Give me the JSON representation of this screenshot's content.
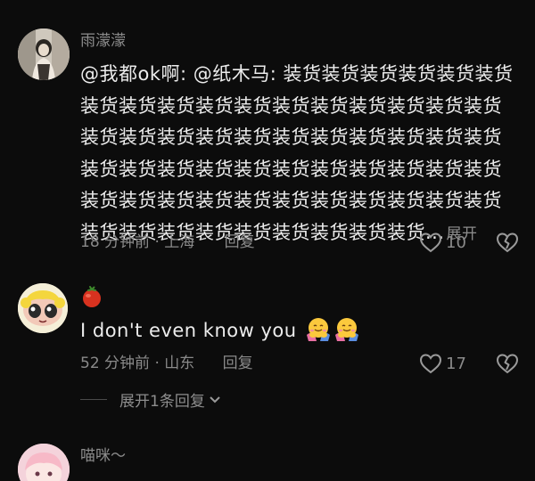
{
  "comments": [
    {
      "username": "雨濛濛",
      "text": "@我都ok啊: @纸木马: 装货装货装货装货装货装货装货装货装货装货装货装货装货装货装货装货装货装货装货装货装货装货装货装货装货装货装货装货装货装货装货装货装货装货装货装货装货装货装货装货装货装货装货装货装货装货装货装货装货装货装货装货装货装货装货装货装货装货装货...",
      "expand_label": "展开",
      "time": "18 分钟前",
      "location": "上海",
      "reply_label": "回复",
      "likes": "10"
    },
    {
      "username_icon": "tomato-icon",
      "text": "I don't even know you",
      "emojis": [
        "hugging-face-emoji",
        "hugging-face-emoji"
      ],
      "time": "52 分钟前",
      "location": "山东",
      "reply_label": "回复",
      "likes": "17",
      "replies_toggle": "展开1条回复"
    },
    {
      "username": "喵咪～"
    }
  ],
  "separator": "·",
  "colors": {
    "background": "#0c0c0c",
    "text": "#ececec",
    "muted": "#8d8d8d"
  }
}
